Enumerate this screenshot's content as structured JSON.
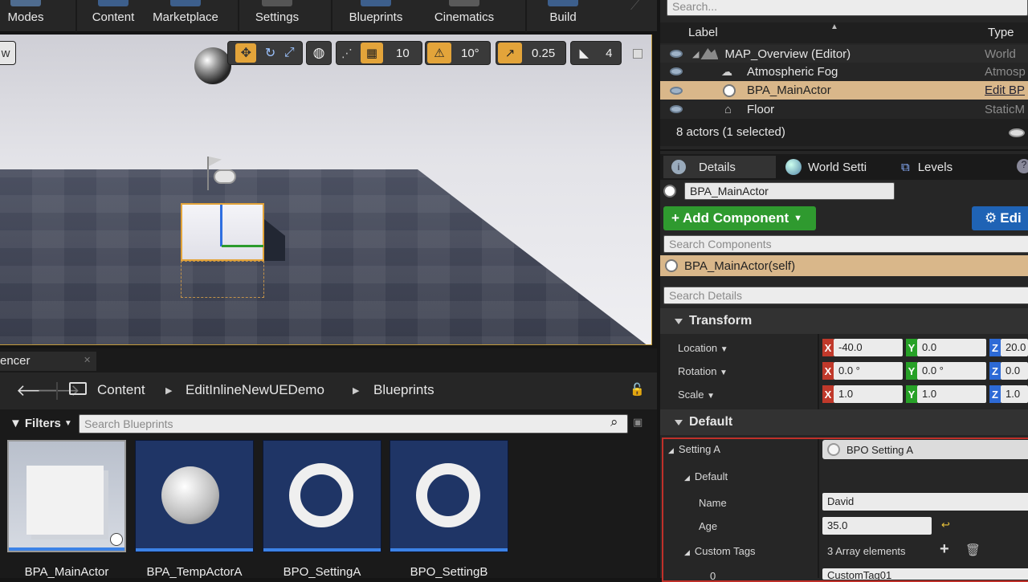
{
  "toolbar": {
    "items": [
      "Modes",
      "Content",
      "Marketplace",
      "Settings",
      "Blueprints",
      "Cinematics",
      "Build"
    ]
  },
  "viewport": {
    "left_button": "w",
    "grid_snap": "10",
    "rotation_snap": "10°",
    "scale_snap": "0.25",
    "camera_speed": "4"
  },
  "outliner": {
    "search_placeholder": "Search...",
    "col_label": "Label",
    "col_type": "Type",
    "rows": [
      {
        "label": "MAP_Overview (Editor)",
        "type": "World"
      },
      {
        "label": "Atmospheric Fog",
        "type": "Atmosp"
      },
      {
        "label": "BPA_MainActor",
        "type": "Edit BP"
      },
      {
        "label": "Floor",
        "type": "StaticM"
      }
    ],
    "status": "8 actors (1 selected)"
  },
  "details": {
    "tabs": [
      "Details",
      "World Setti",
      "Levels"
    ],
    "actor_name": "BPA_MainActor",
    "add_component": "Add Component",
    "edit_button": "Edi",
    "search_components": "Search Components",
    "self_component": "BPA_MainActor(self)",
    "search_details": "Search Details",
    "transform_header": "Transform",
    "location_label": "Location",
    "rotation_label": "Rotation",
    "scale_label": "Scale",
    "location": {
      "x": "-40.0",
      "y": "0.0",
      "z": "20.0"
    },
    "rotation": {
      "x": "0.0 °",
      "y": "0.0 °",
      "z": "0.0"
    },
    "scale": {
      "x": "1.0",
      "y": "1.0",
      "z": "1.0"
    },
    "default_header": "Default",
    "setting_a_label": "Setting A",
    "setting_a_value": "BPO Setting A",
    "default_sub": "Default",
    "name_label": "Name",
    "name_value": "David",
    "age_label": "Age",
    "age_value": "35.0",
    "custom_tags_label": "Custom Tags",
    "custom_tags_value": "3 Array elements",
    "tag_index": "0",
    "tag0_value": "CustomTag01",
    "axis_x": "X",
    "axis_y": "Y",
    "axis_z": "Z"
  },
  "content_browser": {
    "tab_label": "encer",
    "path": [
      "Content",
      "EditInlineNewUEDemo",
      "Blueprints"
    ],
    "filters": "Filters",
    "search_placeholder": "Search Blueprints",
    "assets": [
      "BPA_MainActor",
      "BPA_TempActorA",
      "BPO_SettingA",
      "BPO_SettingB"
    ]
  }
}
